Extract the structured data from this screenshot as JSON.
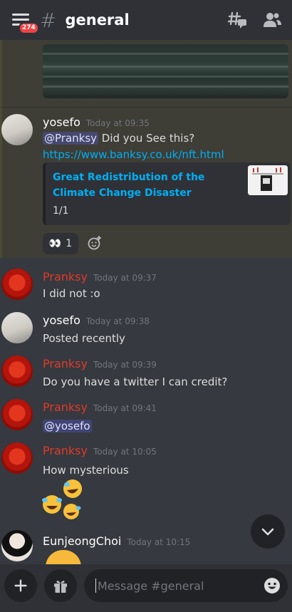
{
  "header": {
    "badge_count": "274",
    "hash_symbol": "#",
    "channel_name": "general"
  },
  "messages": [
    {
      "author": "yosefo",
      "timestamp": "Today at 09:35",
      "mention": "@Pranksy",
      "text": " Did you See this?",
      "link": "https://www.banksy.co.uk/nft.html",
      "embed": {
        "title": "Great Redistribution of the Climate Change Disaster",
        "page": "1/1"
      },
      "reaction": {
        "emoji": "👀",
        "count": "1"
      }
    },
    {
      "author": "Pranksy",
      "timestamp": "Today at 09:37",
      "text": "I did not :o"
    },
    {
      "author": "yosefo",
      "timestamp": "Today at 09:38",
      "text": "Posted recently"
    },
    {
      "author": "Pranksy",
      "timestamp": "Today at 09:39",
      "text": "Do you have a twitter I can credit?"
    },
    {
      "author": "Pranksy",
      "timestamp": "Today at 09:41",
      "mention": "@yosefo"
    },
    {
      "author": "Pranksy",
      "timestamp": "Today at 10:05",
      "text": "How mysterious"
    },
    {
      "author": "EunjeongChoi",
      "timestamp": "Today at 10:15"
    }
  ],
  "composer": {
    "placeholder": "Message #general"
  },
  "colors": {
    "background": "#36393f",
    "header": "#2f3136",
    "link": "#00aff4",
    "pranksy_name": "#e03a2a",
    "mention_badge": "#ed4245"
  }
}
